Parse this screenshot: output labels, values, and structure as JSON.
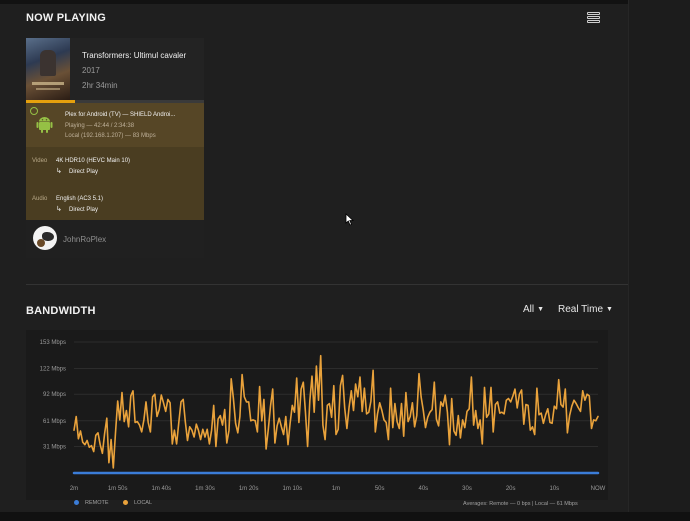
{
  "now_playing": {
    "title": "NOW PLAYING",
    "menu_icon": "list-view-icon",
    "session": {
      "poster_icon": "movie-poster",
      "title": "Transformers: Ultimul cavaler",
      "year": "2017",
      "duration": "2hr 34min",
      "progress_fraction": 0.276,
      "player": "Plex for Android (TV)  —  SHIELD Androi...",
      "status": "Playing — 42:44 / 2:34:38",
      "location": "Local (192.168.1.207) — 83 Mbps",
      "player_icon": "android-icon",
      "secure_icon": "lock-icon",
      "video_label": "Video",
      "video_value": "4K HDR10 (HEVC Main 10)",
      "video_mode": "Direct Play",
      "audio_label": "Audio",
      "audio_value": "English (AC3 5.1)",
      "audio_mode": "Direct Play",
      "direct_play_icon": "direct-play-arrow-icon",
      "username": "JohnRoPlex",
      "avatar_icon": "user-avatar"
    }
  },
  "bandwidth": {
    "title": "BANDWIDTH",
    "filter_dropdown": "All",
    "range_dropdown": "Real Time",
    "legend": {
      "remote": "REMOTE",
      "local": "LOCAL"
    },
    "averages": "Averages: Remote — 0 bps | Local — 61 Mbps",
    "colors": {
      "remote": "#3b7dd8",
      "local": "#e9a23b",
      "accent": "#e5a00d"
    }
  },
  "chart_data": {
    "type": "line",
    "y_ticks": [
      "153 Mbps",
      "122 Mbps",
      "92 Mbps",
      "61 Mbps",
      "31 Mbps"
    ],
    "ylim": [
      0,
      153
    ],
    "ylabel_unit": "Mbps",
    "x_ticks": [
      "2m",
      "1m 50s",
      "1m 40s",
      "1m 30s",
      "1m 20s",
      "1m 10s",
      "1m",
      "50s",
      "40s",
      "30s",
      "20s",
      "10s",
      "NOW"
    ],
    "grid": true,
    "series": [
      {
        "name": "REMOTE",
        "color": "#3b7dd8",
        "values": [
          0,
          0,
          0,
          0,
          0,
          0,
          0,
          0,
          0,
          0,
          0,
          0,
          0,
          0,
          0,
          0,
          0,
          0,
          0,
          0,
          0,
          0,
          0,
          0,
          0,
          0,
          0,
          0,
          0,
          0,
          0,
          0,
          0,
          0,
          0,
          0,
          0,
          0,
          0,
          0,
          0,
          0,
          0,
          0,
          0,
          0,
          0,
          0,
          0,
          0,
          0,
          0,
          0,
          0,
          0,
          0,
          0,
          0,
          0,
          0,
          0,
          0,
          0,
          0,
          0,
          0,
          0,
          0,
          0,
          0,
          0,
          0,
          0,
          0,
          0,
          0,
          0,
          0,
          0,
          0,
          0,
          0,
          0,
          0,
          0,
          0,
          0,
          0,
          0,
          0,
          0,
          0,
          0,
          0,
          0,
          0,
          0,
          0,
          0,
          0,
          0,
          0,
          0,
          0,
          0,
          0,
          0,
          0,
          0,
          0,
          0,
          0,
          0,
          0,
          0,
          0,
          0,
          0,
          0,
          0,
          0
        ]
      },
      {
        "name": "LOCAL",
        "color": "#e9a23b",
        "values": [
          50,
          66,
          40,
          49,
          36,
          33,
          38,
          30,
          32,
          25,
          44,
          47,
          33,
          23,
          46,
          64,
          12,
          39,
          6,
          47,
          84,
          62,
          94,
          60,
          73,
          54,
          90,
          96,
          59,
          60,
          56,
          48,
          62,
          83,
          59,
          48,
          89,
          92,
          66,
          74,
          91,
          82,
          72,
          86,
          82,
          34,
          50,
          34,
          59,
          83,
          86,
          60,
          38,
          54,
          50,
          42,
          57,
          50,
          39,
          51,
          42,
          51,
          34,
          50,
          79,
          31,
          63,
          67,
          56,
          74,
          35,
          50,
          110,
          87,
          58,
          47,
          66,
          115,
          89,
          83,
          83,
          61,
          62,
          61,
          48,
          101,
          61,
          86,
          28,
          51,
          78,
          98,
          35,
          55,
          64,
          54,
          45,
          66,
          33,
          58,
          79,
          71,
          111,
          59,
          98,
          106,
          72,
          31,
          84,
          113,
          71,
          125,
          85,
          137,
          56,
          39,
          79,
          81,
          65,
          102,
          45,
          51,
          102,
          114,
          76,
          52,
          77,
          96,
          73,
          104,
          89,
          112,
          72,
          99,
          69,
          71,
          84,
          120,
          48,
          69,
          82,
          73,
          62,
          59,
          39,
          99,
          53,
          81,
          60,
          52,
          81,
          43,
          94,
          60,
          66,
          82,
          54,
          67,
          116,
          89,
          73,
          53,
          65,
          71,
          74,
          106,
          63,
          55,
          83,
          78,
          91,
          71,
          33,
          87,
          49,
          44,
          67,
          41,
          62,
          53,
          72,
          75,
          112,
          56,
          73,
          52,
          62,
          34,
          100,
          65,
          69,
          100,
          48,
          80,
          83,
          70,
          71,
          69,
          85,
          87,
          83,
          90,
          98,
          76,
          92,
          97,
          57,
          80,
          79,
          50,
          54,
          45,
          99,
          68,
          70,
          58,
          68,
          75,
          59,
          58,
          78,
          75,
          109,
          80,
          77,
          98,
          47,
          67,
          78,
          85,
          81,
          76,
          72,
          96,
          85,
          92,
          90,
          52,
          62,
          61,
          66
        ]
      }
    ]
  }
}
